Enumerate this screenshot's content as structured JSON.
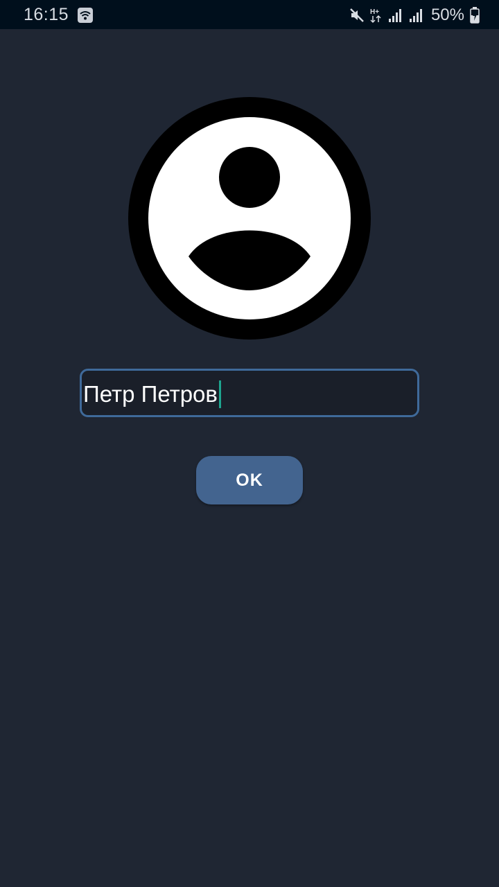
{
  "status_bar": {
    "time": "16:15",
    "battery_percent": "50%",
    "icons": [
      "wifi-calling-icon",
      "mute-icon",
      "h-plus-data-icon",
      "signal-icon",
      "signal-icon",
      "battery-charging-icon"
    ]
  },
  "profile": {
    "avatar_icon": "account-circle-icon",
    "name_value": "Петр Петров"
  },
  "actions": {
    "ok_label": "OK"
  },
  "colors": {
    "background": "#1f2633",
    "status_bar": "#000f1c",
    "field_border": "#3f6a9a",
    "button": "#43648f",
    "caret": "#1ea58f"
  }
}
